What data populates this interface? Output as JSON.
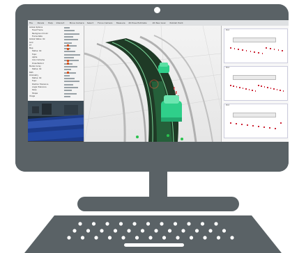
{
  "app": {
    "menu": [
      "File",
      "Panels",
      "Help",
      "Interact",
      "Move Camera",
      "Select",
      "Focus Camera",
      "Measure",
      "2D Pose Estimate",
      "2D Nav Goal",
      "Publish Point"
    ]
  },
  "left_panel": {
    "rows": [
      {
        "label": "Global Options",
        "indent": 0,
        "flag": false
      },
      {
        "label": "Fixed Frame",
        "indent": 1,
        "flag": false
      },
      {
        "label": "Background Color",
        "indent": 1,
        "flag": false
      },
      {
        "label": "Frame Rate",
        "indent": 1,
        "flag": false
      },
      {
        "label": "Global Status: Ok",
        "indent": 0,
        "flag": false
      },
      {
        "label": "Grid",
        "indent": 0,
        "flag": false
      },
      {
        "label": "TF",
        "indent": 0,
        "flag": true
      },
      {
        "label": "Map",
        "indent": 0,
        "flag": true
      },
      {
        "label": "Status: Ok",
        "indent": 1,
        "flag": false
      },
      {
        "label": "Topic",
        "indent": 1,
        "flag": false
      },
      {
        "label": "Alpha",
        "indent": 1,
        "flag": false
      },
      {
        "label": "Color Scheme",
        "indent": 1,
        "flag": true
      },
      {
        "label": "Draw Behind",
        "indent": 1,
        "flag": true
      },
      {
        "label": "Marker Array",
        "indent": 0,
        "flag": false
      },
      {
        "label": "Status: Ok",
        "indent": 1,
        "flag": false
      },
      {
        "label": "Path",
        "indent": 0,
        "flag": true
      },
      {
        "label": "Odometry",
        "indent": 0,
        "flag": false
      },
      {
        "label": "Status: Ok",
        "indent": 1,
        "flag": false
      },
      {
        "label": "Topic",
        "indent": 1,
        "flag": false
      },
      {
        "label": "Position Tolerance",
        "indent": 1,
        "flag": false
      },
      {
        "label": "Angle Tolerance",
        "indent": 1,
        "flag": false
      },
      {
        "label": "Keep",
        "indent": 1,
        "flag": false
      },
      {
        "label": "Shape",
        "indent": 1,
        "flag": false
      },
      {
        "label": "Image",
        "indent": 0,
        "flag": false
      }
    ]
  },
  "right_panel": {
    "plots": [
      {
        "title": "Plot",
        "points": 14
      },
      {
        "title": "Plot",
        "points": 18
      },
      {
        "title": "Plot",
        "points": 10
      }
    ]
  },
  "colors": {
    "frame": "#5a6266",
    "road": "#1f3a26",
    "vehicle": "#2fcf8a",
    "path_dots": "#29c24e"
  }
}
